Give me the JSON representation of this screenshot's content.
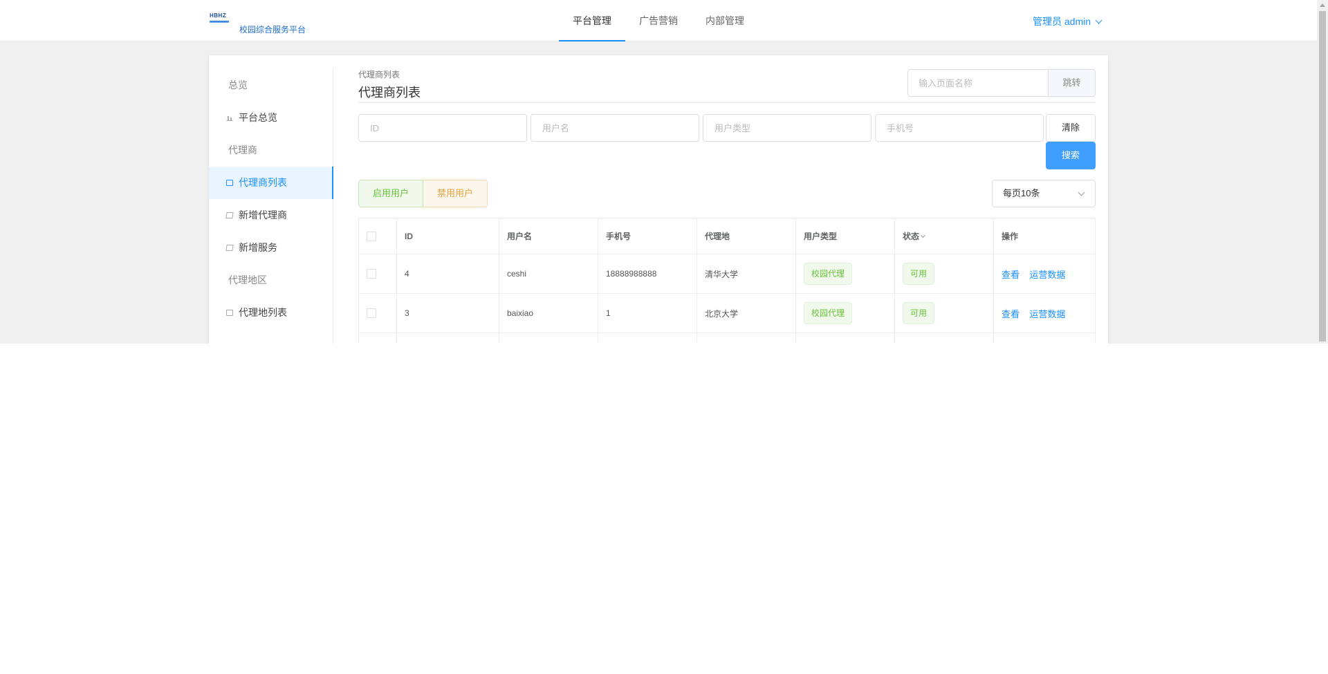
{
  "header": {
    "logo_text": "HBHZ",
    "brand": "校园综合服务平台",
    "nav": [
      {
        "label": "平台管理",
        "active": true
      },
      {
        "label": "广告营销",
        "active": false
      },
      {
        "label": "内部管理",
        "active": false
      }
    ],
    "user_label": "管理员 admin"
  },
  "sidebar": {
    "overview_group": "总览",
    "platform_overview": "平台总览",
    "agent_group": "代理商",
    "agent_list": "代理商列表",
    "add_agent": "新增代理商",
    "add_service": "新增服务",
    "region_group": "代理地区",
    "region_list": "代理地列表"
  },
  "content": {
    "breadcrumb": "代理商列表",
    "title": "代理商列表",
    "jump_placeholder": "输入页面名称",
    "jump_button": "跳转",
    "filters": {
      "id_placeholder": "ID",
      "username_placeholder": "用户名",
      "usertype_placeholder": "用户类型",
      "phone_placeholder": "手机号"
    },
    "clear_button": "清除",
    "search_button": "搜索",
    "enable_button": "启用用户",
    "disable_button": "禁用用户",
    "page_size": "每页10条"
  },
  "table": {
    "columns": [
      "ID",
      "用户名",
      "手机号",
      "代理地",
      "用户类型",
      "状态",
      "操作"
    ],
    "rows": [
      {
        "id": "4",
        "username": "ceshi",
        "phone": "18888988888",
        "region": "清华大学",
        "type": "校园代理",
        "status": "可用",
        "action_view": "查看",
        "action_data": "运营数据"
      },
      {
        "id": "3",
        "username": "baixiao",
        "phone": "1",
        "region": "北京大学",
        "type": "校园代理",
        "status": "可用",
        "action_view": "查看",
        "action_data": "运营数据"
      }
    ]
  },
  "colors": {
    "primary": "#1890ff",
    "search_button": "#409eff",
    "success": "#67c23a",
    "warning": "#e6a23c"
  }
}
